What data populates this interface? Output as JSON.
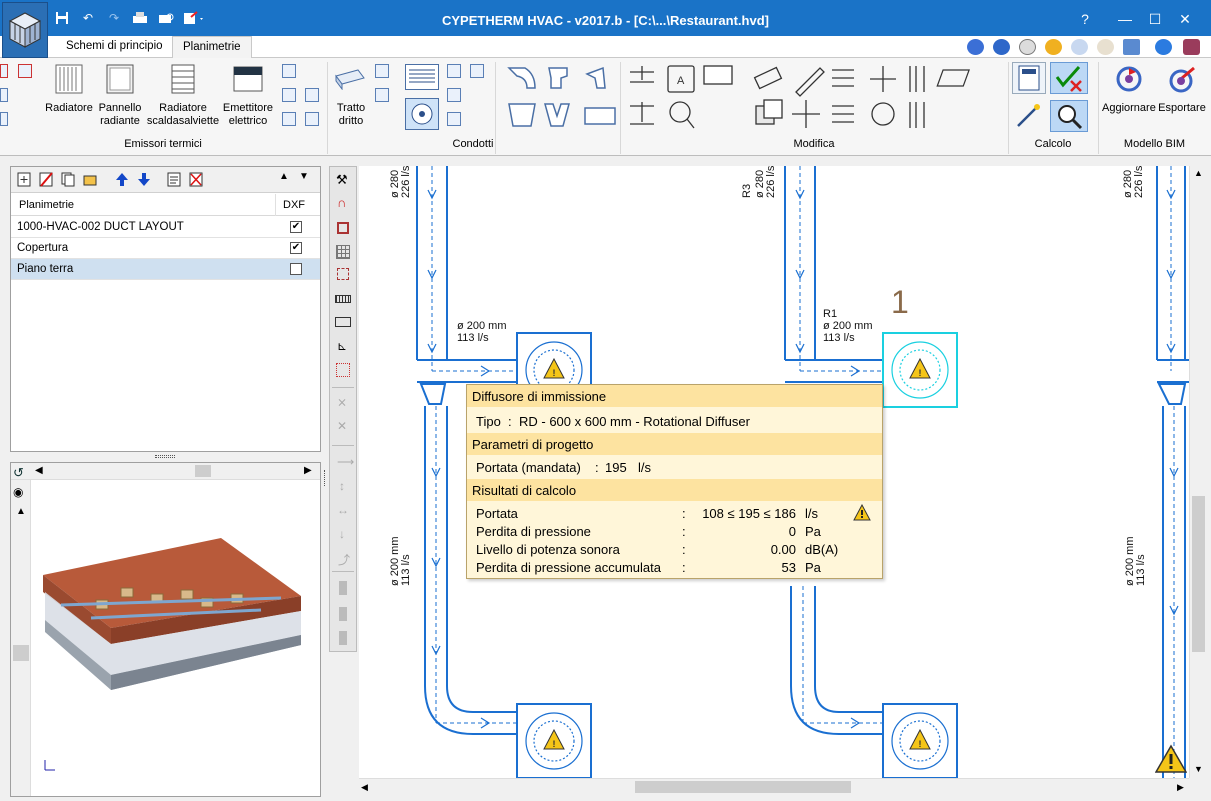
{
  "window": {
    "title": "CYPETHERM HVAC - v2017.b - [C:\\...\\Restaurant.hvd]",
    "help_label": "?",
    "min_label": "—",
    "max_label": "☐",
    "close_label": "✕"
  },
  "tabs": [
    {
      "label": "Schemi di principio"
    },
    {
      "label": "Planimetrie"
    }
  ],
  "ribbon": {
    "groups": {
      "emettitori": "Emissori termici",
      "condotti": "Condotti",
      "modifica": "Modifica",
      "calcolo": "Calcolo",
      "bim": "Modello BIM"
    },
    "buttons": {
      "radiatore": "Radiatore",
      "pannello_1": "Pannello",
      "pannello_2": "radiante",
      "scalda_1": "Radiatore",
      "scalda_2": "scaldasalviette",
      "emettitore_1": "Emettitore",
      "emettitore_2": "elettrico",
      "tratto_1": "Tratto",
      "tratto_2": "dritto",
      "aggiornare": "Aggiornare",
      "esportare": "Esportare"
    }
  },
  "planimetrie": {
    "col_name": "Planimetrie",
    "col_dxf": "DXF",
    "rows": [
      {
        "name": "1000-HVAC-002 DUCT LAYOUT",
        "dxf": "✔"
      },
      {
        "name": "Copertura",
        "dxf": "✔"
      },
      {
        "name": "Piano terra",
        "dxf": ""
      }
    ]
  },
  "canvas": {
    "labels": {
      "top_left_d": "ø 280",
      "top_left_f": "226 l/s",
      "top_mid_r": "R3",
      "top_mid_d": "ø 280",
      "top_mid_f": "226 l/s",
      "top_right_d": "ø 280",
      "top_right_f": "226 l/s",
      "diff_left_d": "ø 200 mm",
      "diff_left_f": "113 l/s",
      "diff_mid_r": "R1",
      "diff_mid_d": "ø 200 mm",
      "diff_mid_f": "113 l/s",
      "side_left_d": "ø 200 mm",
      "side_left_f": "113 l/s",
      "side_right_d": "ø 200 mm",
      "side_right_f": "113 l/s",
      "marker": "1"
    }
  },
  "tooltip": {
    "title": "Diffusore di immissione",
    "tipo_label": "Tipo",
    "tipo_value": "RD - 600 x 600 mm - Rotational Diffuser",
    "params_title": "Parametri di progetto",
    "portata_mandata_label": "Portata (mandata)",
    "portata_mandata_value": "195",
    "portata_mandata_unit": "l/s",
    "results_title": "Risultati di calcolo",
    "results": [
      {
        "label": "Portata",
        "value": "108 ≤ 195 ≤ 186",
        "unit": "l/s"
      },
      {
        "label": "Perdita di pressione",
        "value": "0",
        "unit": "Pa"
      },
      {
        "label": "Livello di potenza sonora",
        "value": "0.00",
        "unit": "dB(A)"
      },
      {
        "label": "Perdita di pressione accumulata",
        "value": "53",
        "unit": "Pa"
      }
    ],
    "sep": ":"
  },
  "colors": {
    "titlebar": "#1a73c7",
    "duct": "#1a6fd1",
    "selected": "#1ad0e0",
    "tooltip_head": "#fde3a0",
    "tooltip_body": "#fff6d9",
    "warning": "#f5c518"
  }
}
